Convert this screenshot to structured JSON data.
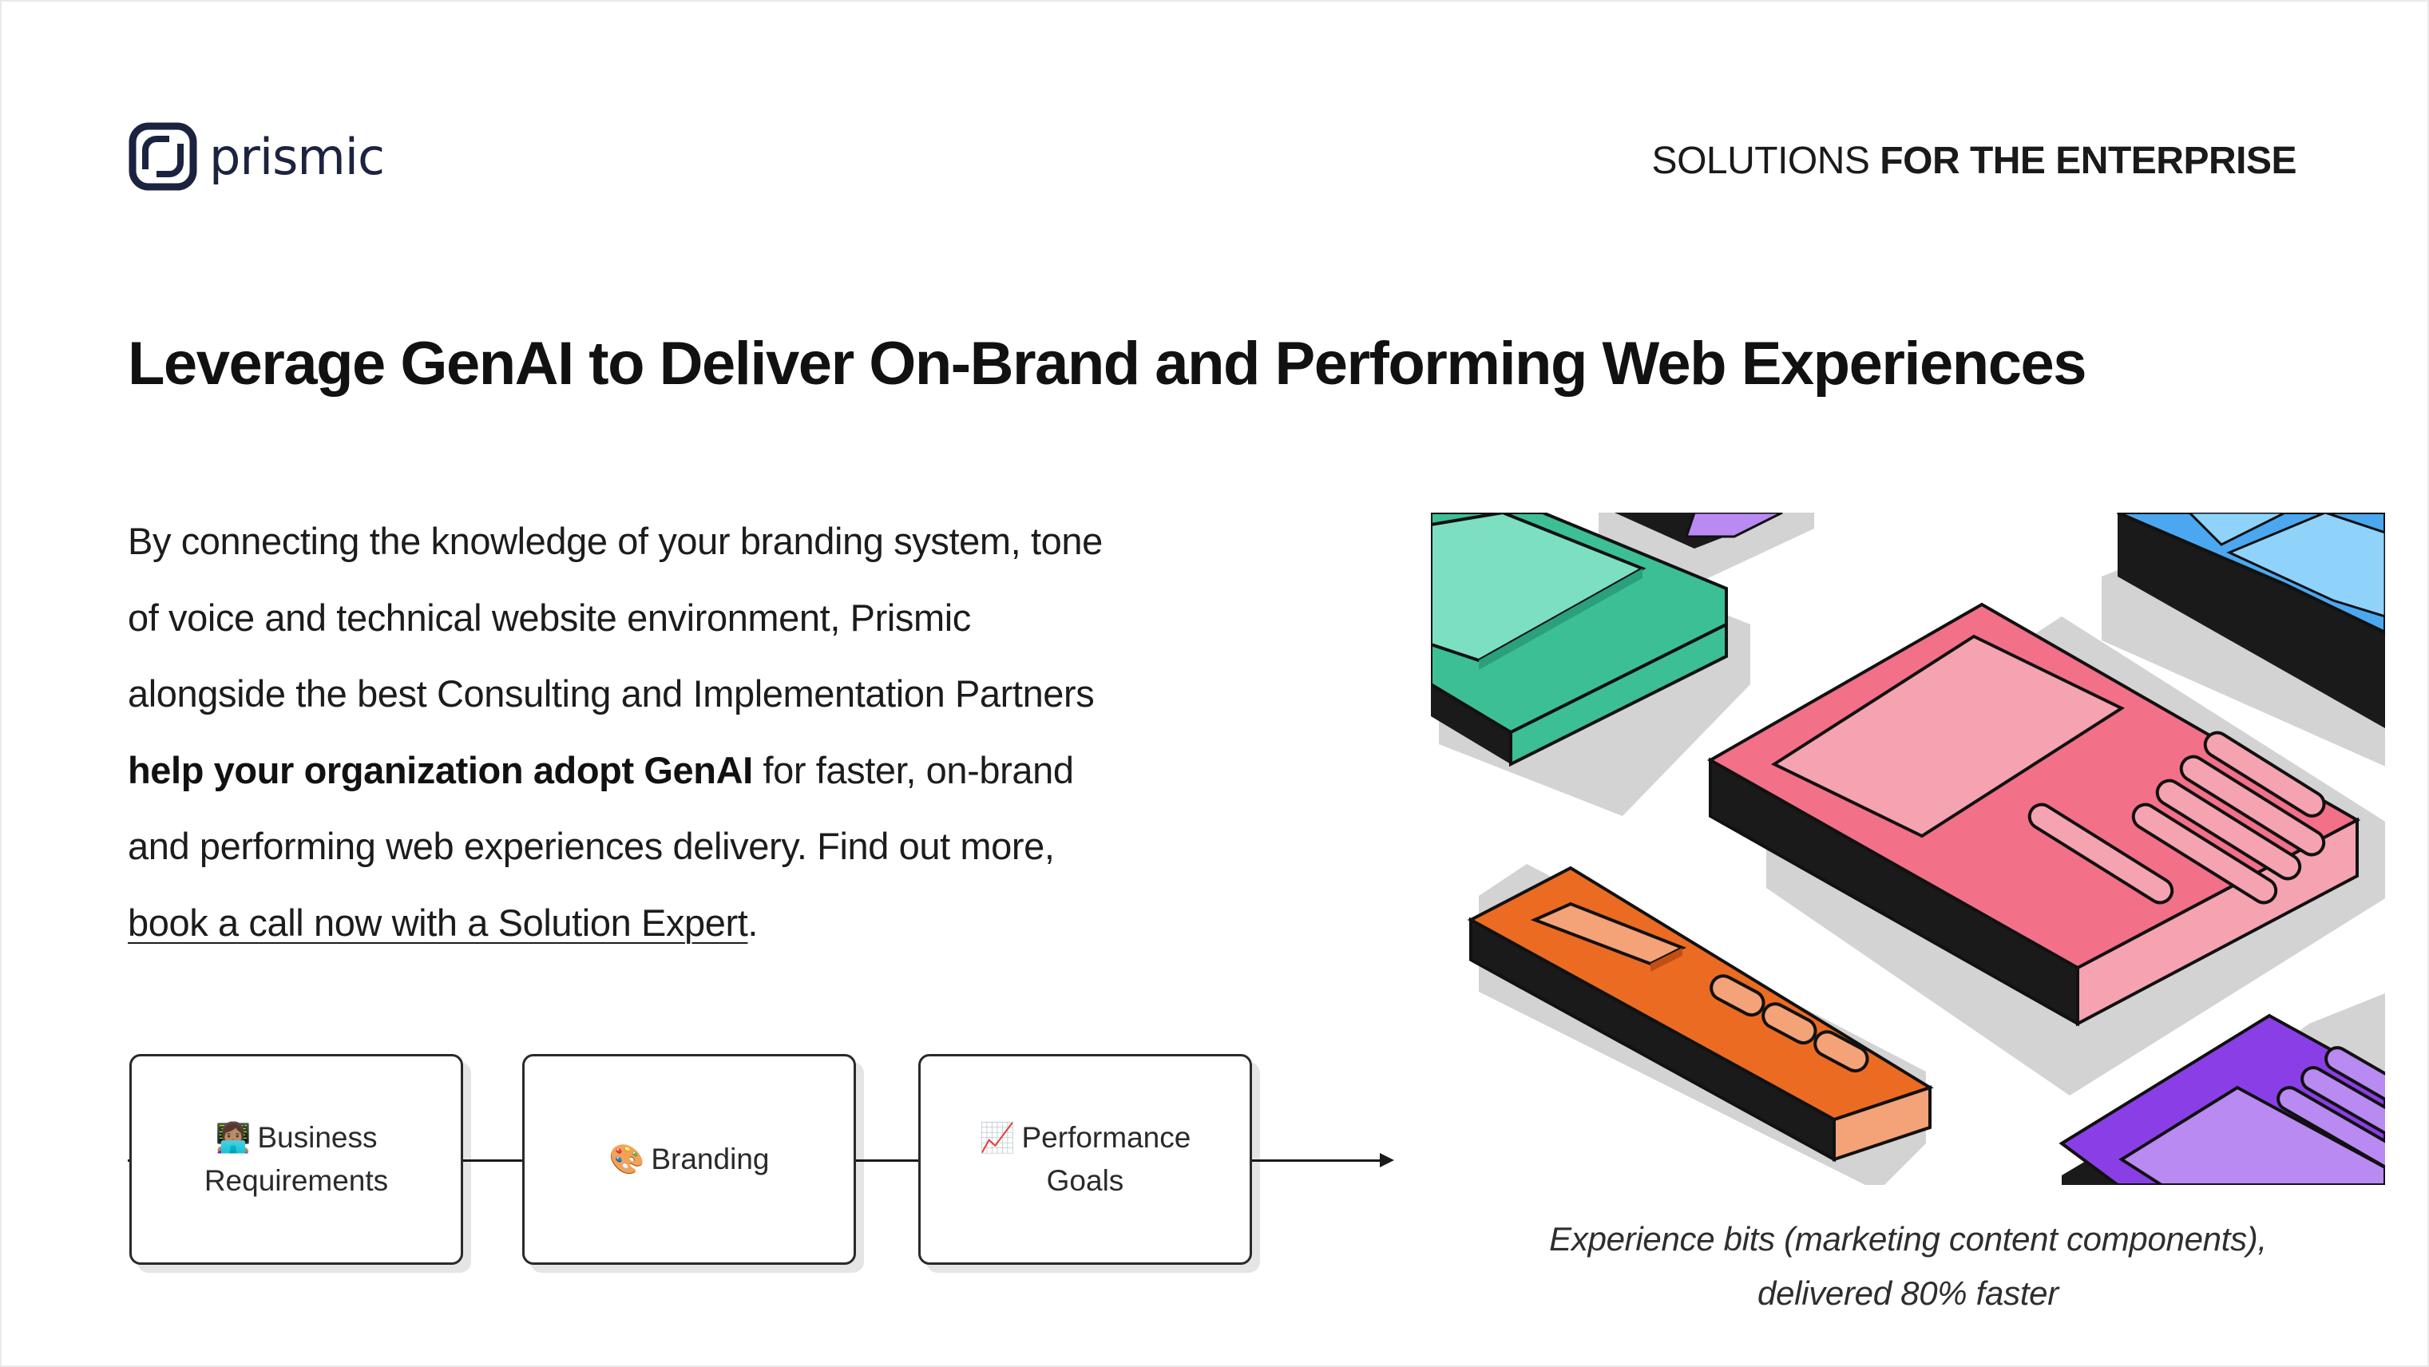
{
  "brand": {
    "name": "prismic"
  },
  "eyebrow": {
    "light": "SOLUTIONS",
    "bold": "FOR THE ENTERPRISE"
  },
  "headline": "Leverage GenAI to Deliver On-Brand and Performing Web Experiences",
  "body": {
    "part1": "By connecting the knowledge of your branding system, tone of voice and technical website environment, Prismic alongside the best Consulting and Implementation Partners ",
    "emphasis": "help your organization adopt GenAI",
    "part2": " for faster, on-brand and performing web experiences delivery. Find out more, ",
    "link": "book a call now with a Solution Expert",
    "end": "."
  },
  "flow": {
    "steps": [
      {
        "emoji": "👩🏽‍💻",
        "line1": "Business",
        "line2": "Requirements"
      },
      {
        "emoji": "🎨",
        "label": "Branding"
      },
      {
        "emoji": "📈",
        "line1": "Performance",
        "line2": "Goals"
      }
    ]
  },
  "caption": {
    "line1": "Experience bits (marketing content components),",
    "line2": "delivered 80% faster"
  },
  "colors": {
    "ink": "#1c2340",
    "green": "#3dbf96",
    "green_light": "#7ddfc2",
    "pink": "#f27088",
    "pink_light": "#f5a3b1",
    "orange": "#ec6b23",
    "orange_light": "#f4a277",
    "blue": "#4ba8f0",
    "blue_light": "#8fd3fb",
    "purple": "#8a3fe6",
    "purple_light": "#b88af2"
  }
}
